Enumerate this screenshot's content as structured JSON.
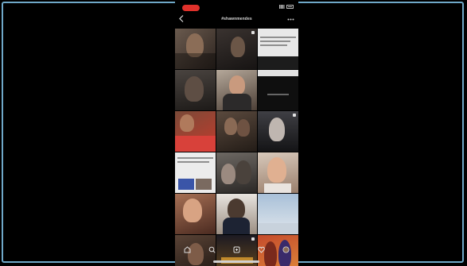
{
  "status_bar": {
    "recording_label": "REC"
  },
  "header": {
    "back_icon": "chevron-left-icon",
    "title": "#shawnmendes",
    "more_icon": "more-icon"
  },
  "grid": {
    "tiles": [
      "post-1",
      "post-2",
      "post-3",
      "post-4",
      "post-5",
      "post-6",
      "post-7",
      "post-8",
      "post-9",
      "post-10",
      "post-11",
      "post-12",
      "post-13",
      "post-14",
      "post-15",
      "post-16",
      "post-17",
      "post-18"
    ]
  },
  "bottom_nav": {
    "items": [
      "home-icon",
      "search-icon",
      "add-post-icon",
      "heart-icon",
      "profile-icon"
    ]
  },
  "colors": {
    "background": "#000000",
    "frame_border": "#6fa8c8",
    "record_pill": "#e0312b"
  }
}
